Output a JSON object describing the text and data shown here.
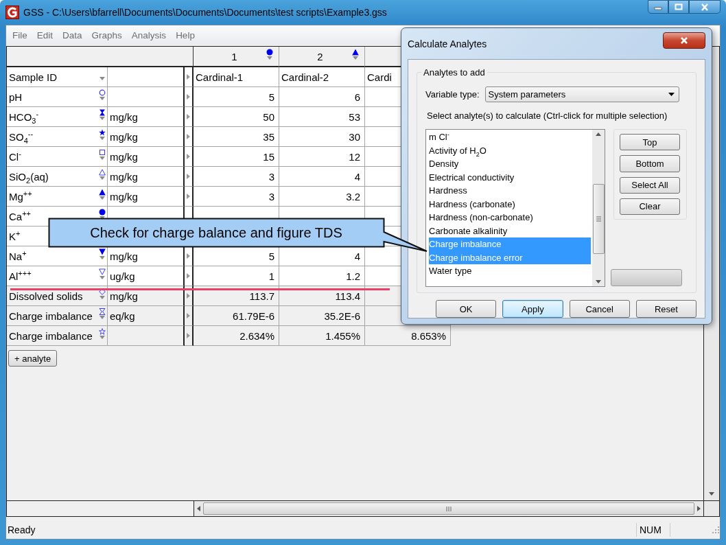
{
  "window": {
    "title": "GSS - C:\\Users\\bfarrell\\Documents\\Documents\\Documents\\test scripts\\Example3.gss"
  },
  "menu": [
    "File",
    "Edit",
    "Data",
    "Graphs",
    "Analysis",
    "Help"
  ],
  "grid": {
    "sample_id_label": "Sample ID",
    "columns": [
      {
        "number": "1",
        "kind": "circle-filled",
        "sample_id": "Cardinal-1"
      },
      {
        "number": "2",
        "kind": "triangle-filled",
        "sample_id": "Cardinal-2"
      },
      {
        "sample_id": "Cardi"
      }
    ],
    "rows": [
      {
        "name": "pH",
        "kind": "circle",
        "calculated": false,
        "values": [
          "5",
          "6"
        ]
      },
      {
        "name": "HCO$_{3}$$^{-}$",
        "kind": "hourglass-filled",
        "units": "mg/kg",
        "calculated": false,
        "values": [
          "50",
          "53"
        ]
      },
      {
        "name": "SO$_{4}$$^{--}$",
        "kind": "star-filled",
        "units": "mg/kg",
        "calculated": false,
        "values": [
          "35",
          "30"
        ]
      },
      {
        "name": "Cl$^{-}$",
        "kind": "square",
        "units": "mg/kg",
        "calculated": false,
        "values": [
          "15",
          "12"
        ]
      },
      {
        "name": "SiO$_{2}$(aq)",
        "kind": "triangle",
        "units": "mg/kg",
        "calculated": false,
        "values": [
          "3",
          "4"
        ]
      },
      {
        "name": "Mg$^{++}$",
        "kind": "triangle-filled",
        "units": "mg/kg",
        "calculated": false,
        "values": [
          "3",
          "3.2"
        ]
      },
      {
        "name": "Ca$^{++}$",
        "kind": "circle-filled",
        "calculated": false
      },
      {
        "name": "K$^{+}$",
        "calculated": false
      },
      {
        "name": "Na$^{+}$",
        "kind": "triangle-down-filled",
        "units": "mg/kg",
        "calculated": false,
        "values": [
          "5",
          "4"
        ]
      },
      {
        "name": "Al$^{+++}$",
        "kind": "triangle-down",
        "units": "ug/kg",
        "calculated": false,
        "values": [
          "1",
          "1.2"
        ]
      },
      {
        "name": "Dissolved solids",
        "kind": "diamond",
        "units": "mg/kg",
        "calculated": true,
        "values": [
          "113.7",
          "113.4"
        ]
      },
      {
        "name": "Charge imbalance",
        "kind": "hourglass",
        "units": "eq/kg",
        "calculated": true,
        "values": [
          "61.79E-6",
          "35.2E-6"
        ]
      },
      {
        "name": "Charge imbalance",
        "kind": "star",
        "calculated": true,
        "values": [
          "2.634%",
          "1.455%",
          "8.653%"
        ]
      }
    ],
    "add_button": "+ analyte"
  },
  "callout": {
    "text": "Check for charge balance and figure TDS"
  },
  "dialog": {
    "title": "Calculate Analytes",
    "group_label": "Analytes to add",
    "variable_type_label": "Variable type:",
    "variable_type": "System parameters",
    "instruction": "Select analyte(s) to calculate (Ctrl-click for multiple selection)",
    "analytes": [
      {
        "label": "m Cl$^{-}$",
        "selected": false
      },
      {
        "label": "Activity of H$_{2}$O",
        "selected": false
      },
      {
        "label": "Density",
        "selected": false
      },
      {
        "label": "Electrical conductivity",
        "selected": false
      },
      {
        "label": "Hardness",
        "selected": false
      },
      {
        "label": "Hardness (carbonate)",
        "selected": false
      },
      {
        "label": "Hardness (non-carbonate)",
        "selected": false
      },
      {
        "label": "Carbonate alkalinity",
        "selected": false
      },
      {
        "label": "Charge imbalance",
        "selected": true
      },
      {
        "label": "Charge imbalance error",
        "selected": true
      },
      {
        "label": "Water type",
        "selected": false
      }
    ],
    "side_buttons": [
      "Top",
      "Bottom",
      "Select All",
      "Clear"
    ],
    "buttons": [
      {
        "label": "OK",
        "default": false
      },
      {
        "label": "Apply",
        "default": true
      },
      {
        "label": "Cancel",
        "default": false
      },
      {
        "label": "Reset",
        "default": false
      }
    ]
  },
  "status_bar": {
    "text": "Ready",
    "indicators": [
      "NUM"
    ]
  }
}
